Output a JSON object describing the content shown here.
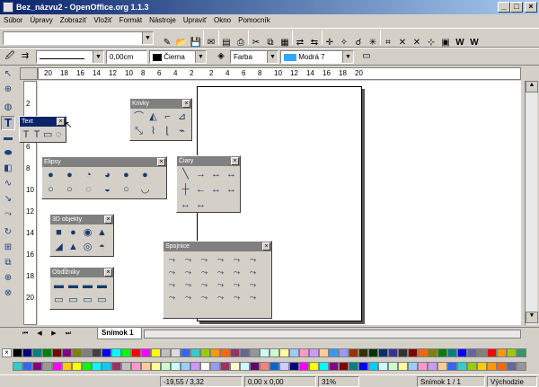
{
  "window": {
    "title": "Bez_názvu2 - OpenOffice.org 1.1.3",
    "minimize": "_",
    "maximize": "□",
    "close": "×"
  },
  "menu": [
    "Súbor",
    "Úpravy",
    "Zobraziť",
    "Vložiť",
    "Formát",
    "Nástroje",
    "Upraviť",
    "Okno",
    "Pomocník"
  ],
  "line_toolbar": {
    "width_value": "0,00cm",
    "line_color": "Čierna",
    "area_style": "Farba",
    "area_color": "Modrá 7"
  },
  "rulers": {
    "h_ticks_left": [
      "20",
      "18",
      "16",
      "14",
      "12",
      "10",
      "8",
      "6",
      "4",
      "2"
    ],
    "h_ticks_right": [
      "2",
      "4",
      "6",
      "8",
      "10",
      "12",
      "14",
      "16",
      "18",
      "20"
    ],
    "v_ticks": [
      "2",
      "4",
      "6",
      "8",
      "10",
      "12",
      "14",
      "16",
      "18",
      "20"
    ]
  },
  "palettes": {
    "text": {
      "title": "Text",
      "icons": [
        "T",
        "T",
        "▭",
        "◌"
      ]
    },
    "curves": {
      "title": "Krivky",
      "icons": [
        "⌒",
        "◭",
        "⌐",
        "⊿",
        "⤡",
        "⌇",
        "⌊",
        "⌁"
      ]
    },
    "ellipses": {
      "title": "Elipsy",
      "icons": [
        "●",
        "●",
        "◔",
        "◕",
        "●",
        "●",
        "○",
        "○",
        "◌",
        "◒",
        "○",
        "◡"
      ]
    },
    "lines": {
      "title": "Čiary",
      "icons": [
        "╲",
        "→",
        "↔",
        "↔",
        "┼",
        "←",
        "↔",
        "↔",
        "↔",
        "↔"
      ]
    },
    "objects3d": {
      "title": "3D objekty",
      "icons": [
        "■",
        "●",
        "◉",
        "▲",
        "◢",
        "▲",
        "◎",
        "◓"
      ]
    },
    "connectors": {
      "title": "Spojnice",
      "icons": [
        "⤳",
        "⤳",
        "⤳",
        "⤳",
        "⤳",
        "⤳",
        "⤳",
        "⤳",
        "⤳",
        "⤳",
        "⤳",
        "⤳",
        "⤳",
        "⤳",
        "⤳",
        "⤳",
        "⤳",
        "⤳",
        "⤳",
        "⤳",
        "⤳",
        "⤳",
        "⤳",
        "⤳"
      ]
    },
    "rectangles": {
      "title": "Obdĺžniky",
      "icons": [
        "▬",
        "▬",
        "▬",
        "▬",
        "▭",
        "▭",
        "▭",
        "▭"
      ]
    }
  },
  "tabs": {
    "current": "Snímok 1"
  },
  "status": {
    "position": "-19,55 / 3,32",
    "size": "0,00 x 0,00",
    "zoom": "31%",
    "page": "Snímok 1 / 1",
    "layout": "Východzie"
  },
  "colors": [
    "#000000",
    "#000080",
    "#008080",
    "#008000",
    "#800000",
    "#800080",
    "#808000",
    "#808080",
    "#404040",
    "#0000ff",
    "#00ffff",
    "#00ff00",
    "#ff0000",
    "#ff00ff",
    "#ffff00",
    "#c0c0c0",
    "#dcdcdc",
    "#3366ff",
    "#33cccc",
    "#99cc00",
    "#ff9900",
    "#ff6600",
    "#993366",
    "#666699",
    "#969696",
    "#ccffff",
    "#ccffcc",
    "#ffff99",
    "#99ccff",
    "#ff99cc",
    "#cc99ff",
    "#ffcc99",
    "#3399ff",
    "#9999ff",
    "#993300",
    "#333300",
    "#003300",
    "#003366",
    "#333399",
    "#333333",
    "#800000",
    "#ff6600",
    "#808000",
    "#008000",
    "#008080",
    "#0000ff",
    "#666699",
    "#808080",
    "#ff0000",
    "#ff9900",
    "#99cc00",
    "#339966",
    "#33cccc",
    "#3366ff",
    "#800080",
    "#999999",
    "#ff00ff",
    "#ffcc00",
    "#ffff00",
    "#00ff00",
    "#00ffff",
    "#00ccff",
    "#993366",
    "#c0c0c0",
    "#ff99cc",
    "#ffcc99",
    "#ffff99",
    "#ccffcc",
    "#ccffff",
    "#99ccff",
    "#cc99ff",
    "#ffffff",
    "#9999ff",
    "#993366",
    "#ffffcc",
    "#ccffff",
    "#660066",
    "#ff8080",
    "#0066cc",
    "#ccccff",
    "#000080",
    "#ff00ff",
    "#ffff00",
    "#00ffff",
    "#800080",
    "#800000",
    "#008080",
    "#0000ff",
    "#00ccff",
    "#ccffff",
    "#ccffcc",
    "#ffff99",
    "#99ccff",
    "#ff99cc",
    "#cc99ff",
    "#ffcc99",
    "#3366ff",
    "#33cccc",
    "#99cc00",
    "#ffcc00",
    "#ff9900",
    "#ff6600",
    "#666699",
    "#969696"
  ]
}
